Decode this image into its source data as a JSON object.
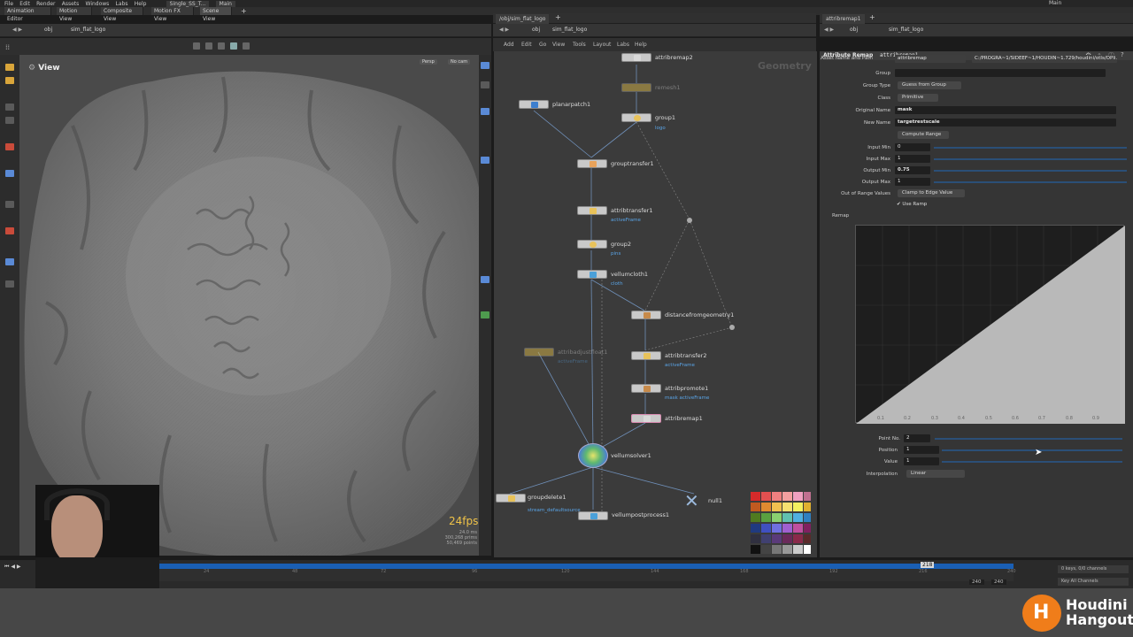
{
  "menubar": {
    "items": [
      "File",
      "Edit",
      "Render",
      "Assets",
      "Windows",
      "Labs",
      "Help"
    ],
    "file_tab": "Single_SS_T...",
    "desktop": "Main",
    "right_desktop": "Main"
  },
  "desktop_tabs": [
    "Animation Editor",
    "Motion View",
    "Composite View",
    "Motion FX View",
    "Scene View"
  ],
  "viewport": {
    "path_obj": "obj",
    "path_node": "sim_flat_logo",
    "title": "View",
    "persp": "Persp",
    "cam": "No cam",
    "fps": "24fps",
    "stats": [
      "24.0 ms",
      "300,268 prims",
      "50,469 points"
    ]
  },
  "network": {
    "tab": "/obj/sim_flat_logo",
    "path_obj": "obj",
    "path_node": "sim_flat_logo",
    "menu": [
      "Add",
      "Edit",
      "Go",
      "View",
      "Tools",
      "Layout",
      "Labs",
      "Help"
    ],
    "watermark": "Geometry",
    "nodes": {
      "attribremap2": "attribremap2",
      "remesh1": "remesh1",
      "planarpatch1": "planarpatch1",
      "group1": "group1",
      "group1_sub": "logo",
      "grouptransfer1": "grouptransfer1",
      "attribtransfer1": "attribtransfer1",
      "attribtransfer1_sub": "activeFrame",
      "group2": "group2",
      "group2_sub": "pins",
      "vellumcloth1": "vellumcloth1",
      "vellumcloth1_sub": "cloth",
      "distancefromgeometry1": "distancefromgeometry1",
      "attribadjustfloat1": "attribadjustfloat1",
      "attribadjustfloat1_sub": "activeFrame",
      "attribtransfer2": "attribtransfer2",
      "attribtransfer2_sub": "activeFrame",
      "attribpromote1": "attribpromote1",
      "attribpromote1_sub": "mask activeFrame",
      "attribremap1": "attribremap1",
      "vellumsolver1": "vellumsolver1",
      "groupdelete1": "groupdelete1",
      "groupdelete1_sub": "stream_defaultsource",
      "vellumpostprocess1": "vellumpostprocess1",
      "null1": "null1"
    }
  },
  "params": {
    "tab": "attribremap1",
    "path_obj": "obj",
    "path_node": "sim_flat_logo",
    "node_type": "Attribute Remap",
    "node_name": "attribremap1",
    "asset_label": "Asset Name and Path",
    "asset_name": "attribremap",
    "asset_path": "C:/PROGRA~1/SIDEEF~1/HOUDIN~1.729/houdini/otls/OPli...",
    "group_label": "Group",
    "group_value": "",
    "group_type_label": "Group Type",
    "group_type": "Guess from Group",
    "class_label": "Class",
    "class_value": "Primitive",
    "original_name_label": "Original Name",
    "original_name": "mask",
    "new_name_label": "New Name",
    "new_name": "targetrestscale",
    "compute_range": "Compute Range",
    "input_min_label": "Input Min",
    "input_min": "0",
    "input_max_label": "Input Max",
    "input_max": "1",
    "output_min_label": "Output Min",
    "output_min": "0.75",
    "output_max_label": "Output Max",
    "output_max": "1",
    "out_of_range_label": "Out of Range Values",
    "out_of_range": "Clamp to Edge Value",
    "use_ramp": "Use Ramp",
    "remap_label": "Remap",
    "point_no_label": "Point No.",
    "point_no": "2",
    "position_label": "Position",
    "position": "1",
    "value_label": "Value",
    "value": "1",
    "interp_label": "Interpolation",
    "interp": "Linear",
    "ramp_ticks": [
      "0.1",
      "0.2",
      "0.3",
      "0.4",
      "0.5",
      "0.6",
      "0.7",
      "0.8",
      "0.9"
    ]
  },
  "timeline": {
    "ticks": [
      "24",
      "48",
      "72",
      "96",
      "120",
      "144",
      "168",
      "192",
      "216",
      "240"
    ],
    "current_frame": "218",
    "end1": "240",
    "end2": "240",
    "keys": "0 keys, 0/0 channels",
    "key_all": "Key All Channels"
  },
  "branding": {
    "line1": "Houdini",
    "line2": "Hangout"
  }
}
